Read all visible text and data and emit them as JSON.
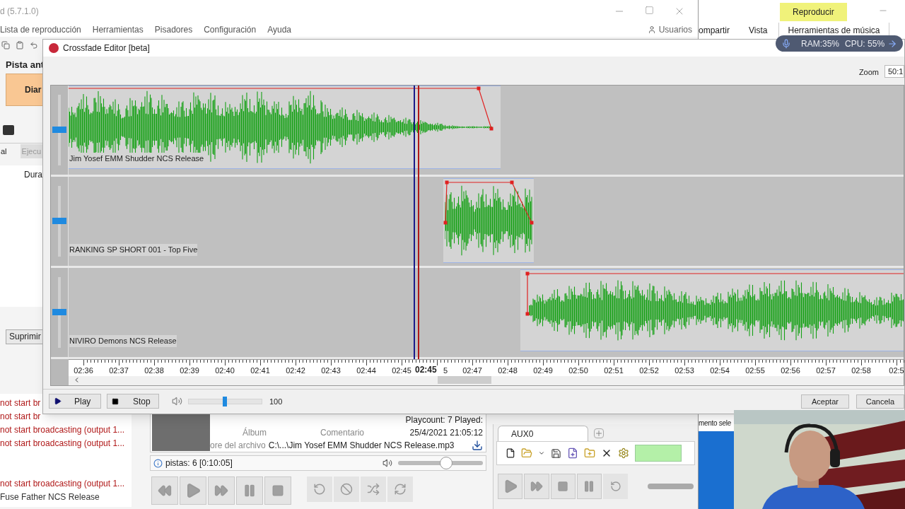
{
  "app": {
    "title": "d (5.7.1.0)",
    "menu": [
      "Lista de reproducción",
      "Herramientas",
      "Pisadores",
      "Configuración",
      "Ayuda"
    ],
    "users_button": "Usuarios"
  },
  "previous_track": {
    "label": "Pista ant",
    "button": "Diar"
  },
  "tabs": [
    {
      "label": "al",
      "selected": true
    },
    {
      "label": "Ejecu",
      "selected": false
    }
  ],
  "list_header": "Dura",
  "delete_button": "Suprimir",
  "log": [
    "not start br",
    "not start br",
    "not start broadcasting (output 1...",
    "not start broadcasting (output 1...",
    "not start broadcasting (output 1...",
    "Fuse Father NCS Release"
  ],
  "track_info": {
    "fields": [
      "Álbum",
      "Comentario",
      "ore del archivo"
    ],
    "file": "C:\\...\\Jim Yosef  EMM  Shudder NCS Release.mp3",
    "playcount": "Playcount: 7  Played:",
    "played_at": "25/4/2021 21:05:12"
  },
  "status": {
    "text": "pistas: 6 [0:10:05]",
    "volume": {
      "level": 0.58
    }
  },
  "aux": {
    "tab": "AUX0"
  },
  "explorer": {
    "context_label": "Reproducir",
    "tabs": [
      {
        "label": "ompartir",
        "selected": false
      },
      {
        "label": "Vista",
        "selected": false
      },
      {
        "label": "Herramientas de música",
        "selected": true
      }
    ],
    "status_text": "mento sele"
  },
  "monitor": {
    "ram": "RAM:35%",
    "cpu": "CPU: 55%"
  },
  "dialog": {
    "title": "Crossfade Editor [beta]",
    "zoom_label": "Zoom",
    "zoom_value": "50:1",
    "tracks": [
      {
        "name": "Jim Yosef  EMM  Shudder NCS Release",
        "level": 0.5
      },
      {
        "name": "RANKING SP SHORT 001 - Top Five",
        "level": 0.5
      },
      {
        "name": "NIVIRO  Demons NCS Release",
        "level": 0.5
      }
    ],
    "ruler": [
      {
        "label": "02:36"
      },
      {
        "label": "02:37"
      },
      {
        "label": "02:38"
      },
      {
        "label": "02:39"
      },
      {
        "label": "02:40"
      },
      {
        "label": "02:41"
      },
      {
        "label": "02:42"
      },
      {
        "label": "02:43"
      },
      {
        "label": "02:44"
      },
      {
        "label": "02:45"
      },
      {
        "label": "5",
        "kind": "partial"
      },
      {
        "label": "02:47"
      },
      {
        "label": "02:48"
      },
      {
        "label": "02:49"
      },
      {
        "label": "02:50"
      },
      {
        "label": "02:51"
      },
      {
        "label": "02:52"
      },
      {
        "label": "02:53"
      },
      {
        "label": "02:54"
      },
      {
        "label": "02:55"
      },
      {
        "label": "02:56"
      },
      {
        "label": "02:57"
      },
      {
        "label": "02:58"
      },
      {
        "label": "02:5"
      }
    ],
    "playhead_label": "02:45",
    "play_button": "Play",
    "stop_button": "Stop",
    "volume": {
      "level": 0.49,
      "reading": "100"
    },
    "buttons": [
      "Aceptar",
      "Cancela"
    ]
  }
}
